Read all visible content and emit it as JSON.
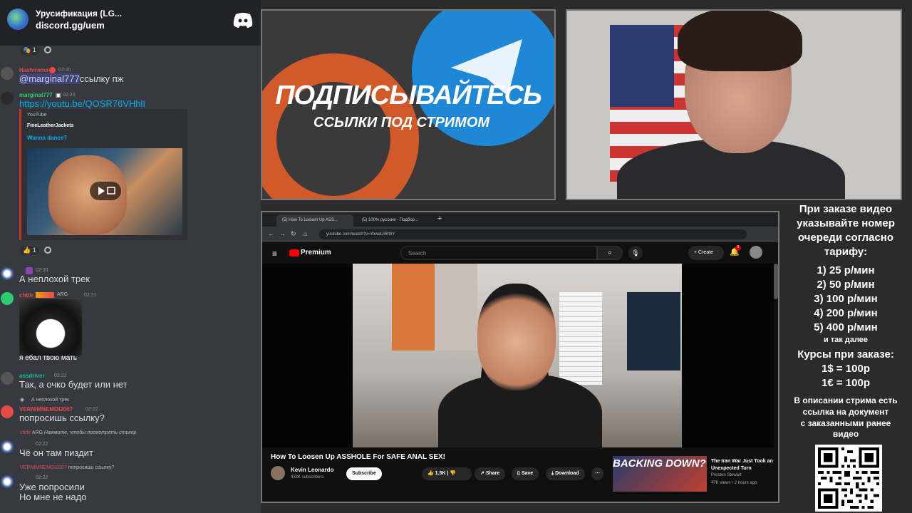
{
  "discord": {
    "server_name": "Урусификация (LG...",
    "server_invite": "discord.gg/uem",
    "reaction_1_count": "1",
    "messages": [
      {
        "user": "Hashirama",
        "time": "02:20",
        "text_mention": "@marginal777",
        "text": "ссылку пж",
        "color": "#e84a4a"
      },
      {
        "user": "marginal777",
        "time": "02:20",
        "text": "https://youtu.be/QOSR76VHhlI",
        "color": "#2ecc71"
      },
      {
        "time": "02:20",
        "text": "А неплохой трек"
      },
      {
        "user": "chttir",
        "badge": "ARG",
        "time": "02:21",
        "caption": "я ебал твою мать",
        "color": "#e84a4a"
      },
      {
        "user": "assdriver",
        "time": "02:22",
        "text": "Так, а очко будет или нет",
        "color": "#1abc9c"
      },
      {
        "reply_text": "А неплохой трек",
        "user": "VERNIMNEMOI2007",
        "time": "02:22",
        "text": "попросишь ссылку?",
        "color": "#e84a4a"
      },
      {
        "reply_user": "chttir",
        "reply_badge": "ARG",
        "reply_text": "Нажмите, чтобы посмотреть стикер",
        "time": "02:22",
        "text": "Чё он там пиздит"
      },
      {
        "reply_user": "VERNIMNEMOI2007",
        "reply_text": "попросишь ссылку?",
        "time": "02:22",
        "text": "Уже попросили",
        "text2": "Но мне не надо"
      }
    ],
    "embed": {
      "provider": "YouTube",
      "author": "FineLeatherJackets",
      "title": "Wanna dance?"
    },
    "reaction_2_count": "1"
  },
  "promo": {
    "title": "ПОДПИСЫВАЙТЕСЬ",
    "subtitle": "ССЫЛКИ ПОД СТРИМОМ"
  },
  "browser": {
    "tab_1": "(5) How To Loosen Up ASS...",
    "tab_2": "(5) 100% русские - Подбор...",
    "url": "youtube.com/watch?v=YowaUiRl9rY",
    "yt_brand": "Premium",
    "search_placeholder": "Search",
    "create_label": "Create",
    "notif_count": "9",
    "video_title": "How To Loosen Up ASSHOLE For SAFE ANAL SEX!",
    "channel_name": "Kevin Leonardo",
    "channel_subs": "433K subscribers",
    "subscribe_label": "Subscribe",
    "like_count": "1.5K",
    "share_label": "Share",
    "save_label": "Save",
    "download_label": "Download",
    "rec_thumb_text": "BACKING DOWN?",
    "rec_title": "The Iran War Just Took an Unexpected Turn",
    "rec_channel": "Preston Stewart",
    "rec_meta": "47K views • 2 hours ago"
  },
  "info": {
    "l1": "При заказе видео",
    "l2": "указывайте номер",
    "l3": "очереди согласно",
    "l4": "тарифу:",
    "t1": "1) 25 р/мин",
    "t2": "2) 50 р/мин",
    "t3": "3) 100 р/мин",
    "t4": "4) 200 р/мин",
    "t5": "5) 400 р/мин",
    "etc": "и так далее",
    "courses": "Курсы при заказе:",
    "c1": "1$ = 100р",
    "c2": "1€ = 100р",
    "d1": "В описании стрима есть",
    "d2": "ссылка на документ",
    "d3": "с заказанными ранее",
    "d4": "видео"
  }
}
